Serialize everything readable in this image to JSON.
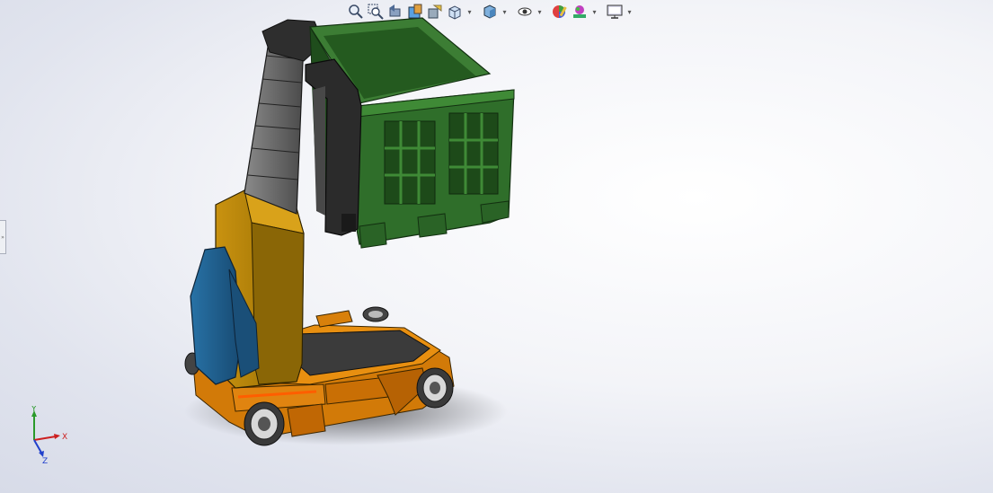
{
  "toolbar": {
    "buttons": [
      {
        "name": "zoom-to-fit-icon",
        "caret": false
      },
      {
        "name": "zoom-to-area-icon",
        "caret": false
      },
      {
        "name": "previous-view-icon",
        "caret": false
      },
      {
        "name": "section-view-icon",
        "caret": false
      },
      {
        "name": "dynamic-annotation-icon",
        "caret": false
      },
      {
        "name": "view-orientation-icon",
        "caret": true
      },
      {
        "name": "display-style-icon",
        "caret": true
      },
      {
        "name": "hide-show-items-icon",
        "caret": true
      },
      {
        "name": "edit-appearance-icon",
        "caret": false
      },
      {
        "name": "apply-scene-icon",
        "caret": true
      },
      {
        "name": "view-settings-icon",
        "caret": true
      }
    ]
  },
  "triad": {
    "x_label": "X",
    "y_label": "Y",
    "z_label": "Z"
  },
  "colors": {
    "crate": "#2f6e2a",
    "crate_dark": "#1f4d1c",
    "body": "#b8860b",
    "base": "#d9830c",
    "blue_panel": "#1f5f8e",
    "mast": "#5e5e5e",
    "accent_strip": "#ff6a00"
  }
}
